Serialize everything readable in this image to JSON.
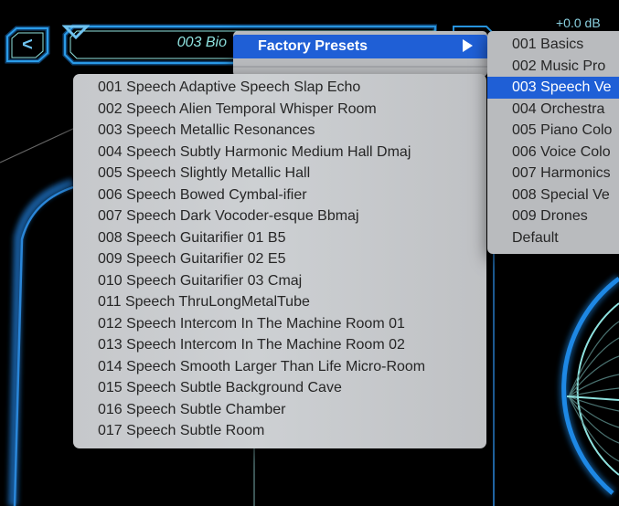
{
  "header": {
    "back_button_label": "<",
    "preset_name": "003 Bio",
    "output_gain": "+0.0 dB"
  },
  "context_menu": {
    "highlighted_item": "Factory Presets"
  },
  "preset_list": {
    "items": [
      "001 Speech Adaptive Speech Slap Echo",
      "002 Speech Alien Temporal Whisper Room",
      "003 Speech Metallic Resonances",
      "004 Speech Subtly Harmonic Medium Hall Dmaj",
      "005 Speech Slightly Metallic Hall",
      "006 Speech Bowed Cymbal-ifier",
      "007 Speech Dark Vocoder-esque Bbmaj",
      "008 Speech Guitarifier 01 B5",
      "009 Speech Guitarifier 02 E5",
      "010 Speech Guitarifier 03 Cmaj",
      "011 Speech ThruLongMetalTube",
      "012 Speech Intercom In The Machine Room 01",
      "013 Speech Intercom In The Machine Room 02",
      "014 Speech Smooth Larger Than Life Micro-Room",
      "015 Speech Subtle Background Cave",
      "016 Speech Subtle Chamber",
      "017 Speech Subtle Room"
    ]
  },
  "category_submenu": {
    "selected_index": 2,
    "items": [
      "001 Basics",
      "002 Music Pro",
      "003 Speech Ve",
      "004 Orchestra",
      "005 Piano Colo",
      "006 Voice Colo",
      "007 Harmonics",
      "008 Special Ve",
      "009 Drones",
      "Default"
    ]
  },
  "colors": {
    "accent_blue": "#1f5fd6",
    "neon_blue": "#1e88e5",
    "neon_cyan": "#8fe3e0"
  }
}
